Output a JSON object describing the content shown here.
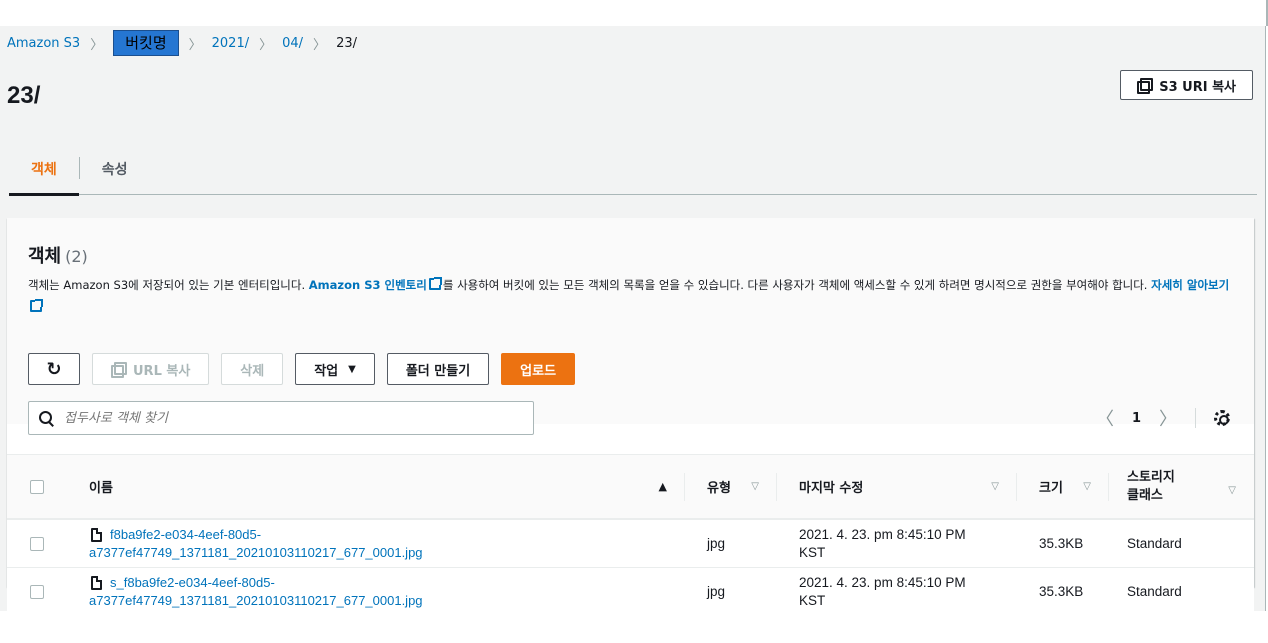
{
  "breadcrumb": [
    {
      "label": "Amazon S3"
    },
    {
      "label": "버킷명"
    },
    {
      "label": "2021/"
    },
    {
      "label": "04/"
    },
    {
      "label": "23/"
    }
  ],
  "page_title": "23/",
  "copy_uri_label": "S3 URI 복사",
  "tabs": [
    {
      "label": "객체",
      "active": true
    },
    {
      "label": "속성",
      "active": false
    }
  ],
  "objects_panel": {
    "title": "객체",
    "count": "(2)",
    "desc_part1": "객체는 Amazon S3에 저장되어 있는 기본 엔터티입니다. ",
    "inventory_link": "Amazon S3 인벤토리",
    "desc_part2": "를 사용하여 버킷에 있는 모든 객체의 목록을 얻을 수 있습니다. 다른 사용자가 객체에 액세스할 수 있게 하려면 명시적으로 권한을 부여해야 합니다. ",
    "learn_more_link": "자세히 알아보기"
  },
  "actions": {
    "copy_url": "URL 복사",
    "delete": "삭제",
    "actions": "작업",
    "create_folder": "폴더 만들기",
    "upload": "업로드"
  },
  "search": {
    "placeholder": "접두사로 객체 찾기"
  },
  "pagination": {
    "page": "1"
  },
  "table": {
    "headers": {
      "name": "이름",
      "type": "유형",
      "modified": "마지막 수정",
      "size": "크기",
      "storage_class_line1": "스토리지",
      "storage_class_line2": "클래스"
    },
    "rows": [
      {
        "name_line1": "f8ba9fe2-e034-4eef-80d5-",
        "name_line2": "a7377ef47749_1371181_20210103110217_677_0001.jpg",
        "type": "jpg",
        "modified_line1": "2021. 4. 23. pm 8:45:10 PM",
        "modified_line2": "KST",
        "size": "35.3KB",
        "storage_class": "Standard"
      },
      {
        "name_line1": "s_f8ba9fe2-e034-4eef-80d5-",
        "name_line2": "a7377ef47749_1371181_20210103110217_677_0001.jpg",
        "type": "jpg",
        "modified_line1": "2021. 4. 23. pm 8:45:10 PM",
        "modified_line2": "KST",
        "size": "35.3KB",
        "storage_class": "Standard"
      }
    ]
  },
  "colors": {
    "accent": "#ec7211",
    "link": "#0073bb",
    "highlight": "#2576d2"
  }
}
